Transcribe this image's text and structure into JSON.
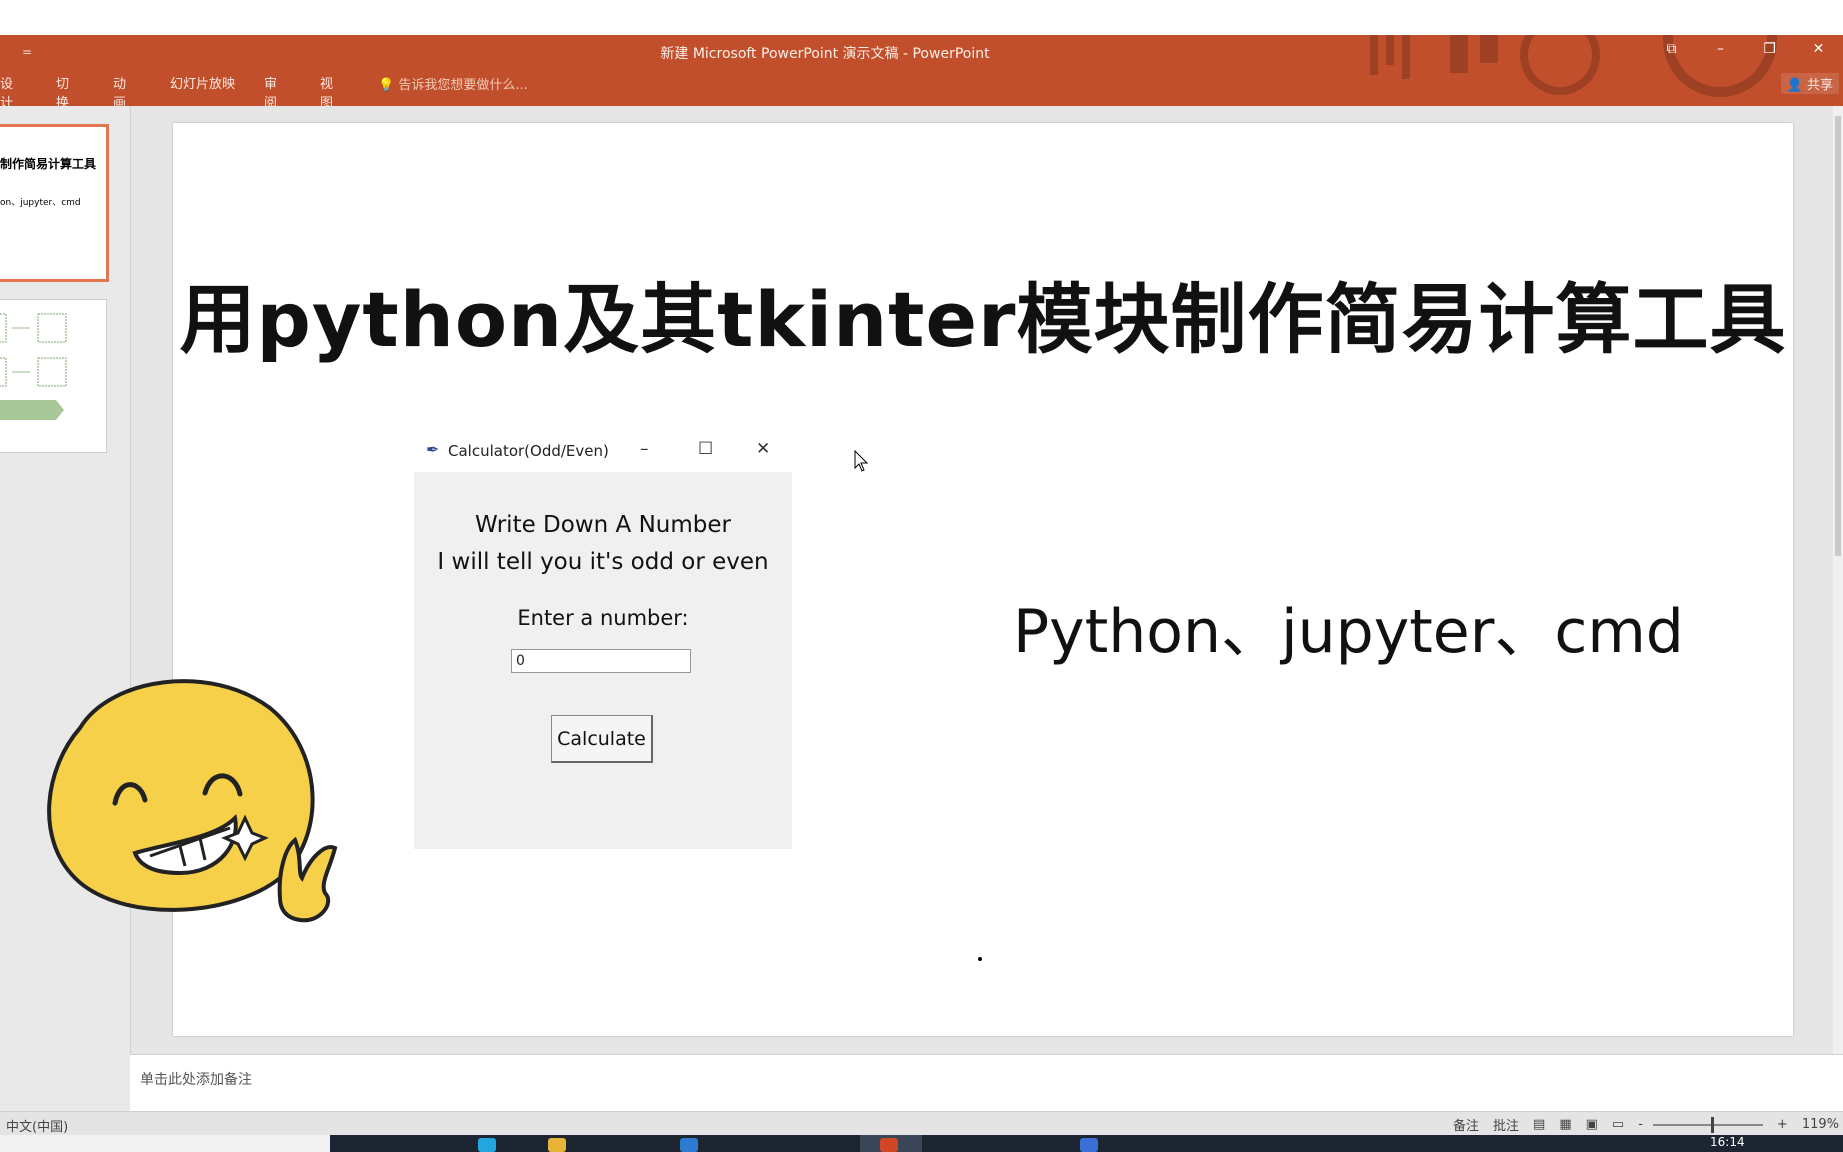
{
  "powerpoint": {
    "window_title": "新建 Microsoft PowerPoint 演示文稿 - PowerPoint",
    "quick_access_arrow": "=",
    "window_controls": [
      "⧉",
      "–",
      "❐",
      "✕"
    ],
    "ribbon_tabs": [
      "设计",
      "切换",
      "动画",
      "幻灯片放映",
      "审阅",
      "视图"
    ],
    "tell_me": "告诉我您想要做什么...",
    "share_label": "共享"
  },
  "thumbnails": {
    "slide1_title": "制作简易计算工具",
    "slide1_sub": "on、jupyter、cmd"
  },
  "slide": {
    "title": "用python及其tkinter模块制作简易计算工具",
    "subtitle": "Python、jupyter、cmd"
  },
  "tk_window": {
    "title": "Calculator(Odd/Even)",
    "line1": "Write Down A Number",
    "line2": "I will tell you it's odd or even",
    "prompt": "Enter a number:",
    "input_value": "0",
    "button": "Calculate"
  },
  "notes_placeholder": "单击此处添加备注",
  "status": {
    "language": "中文(中国)",
    "notes_btn": "备注",
    "comments_btn": "批注",
    "zoom_minus": "-",
    "zoom_plus": "+",
    "zoom": "119%"
  },
  "taskbar": {
    "time": "16:14"
  }
}
